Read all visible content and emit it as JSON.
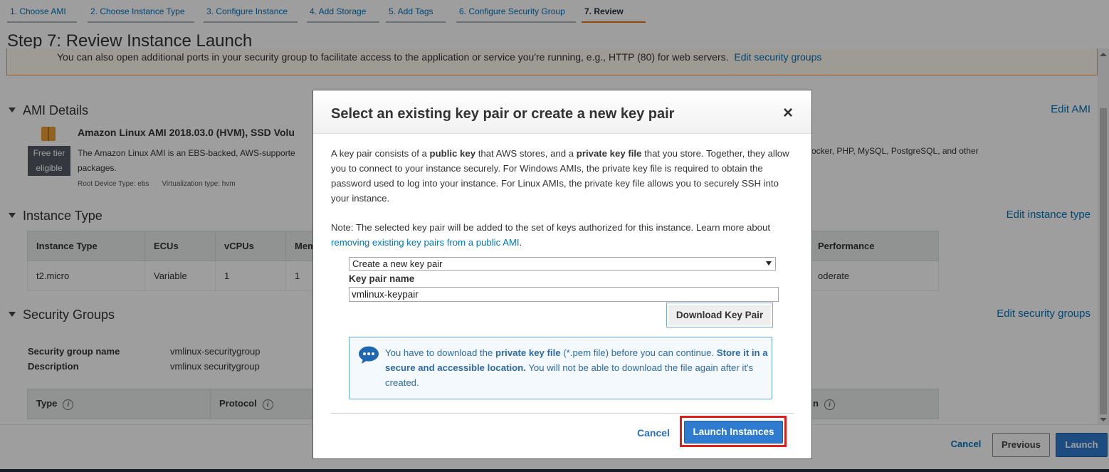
{
  "wizard_tabs": [
    {
      "label": "1. Choose AMI"
    },
    {
      "label": "2. Choose Instance Type"
    },
    {
      "label": "3. Configure Instance"
    },
    {
      "label": "4. Add Storage"
    },
    {
      "label": "5. Add Tags"
    },
    {
      "label": "6. Configure Security Group"
    },
    {
      "label": "7. Review"
    }
  ],
  "page": {
    "title": "Step 7: Review Instance Launch",
    "notice_text": "You can also open additional ports in your security group to facilitate access to the application or service you're running, e.g., HTTP (80) for web servers.",
    "notice_link": "Edit security groups"
  },
  "ami_section": {
    "heading": "AMI Details",
    "edit_link": "Edit AMI",
    "ami_title": "Amazon Linux AMI 2018.03.0 (HVM), SSD Volu",
    "free_tier_line1": "Free tier",
    "free_tier_line2": "eligible",
    "desc_left": "The Amazon Linux AMI is an EBS-backed, AWS-supporte",
    "desc_right": "ocker, PHP, MySQL, PostgreSQL, and other",
    "desc_line2": "packages.",
    "root_device": "Root Device Type: ebs",
    "virtualization": "Virtualization type: hvm"
  },
  "instance_section": {
    "heading": "Instance Type",
    "edit_link": "Edit instance type",
    "columns": [
      "Instance Type",
      "ECUs",
      "vCPUs",
      "Mem",
      "Performance"
    ],
    "row": [
      "t2.micro",
      "Variable",
      "1",
      "1",
      "oderate"
    ]
  },
  "security_section": {
    "heading": "Security Groups",
    "edit_link": "Edit security groups",
    "name_label": "Security group name",
    "name_value": "vmlinux-securitygroup",
    "desc_label": "Description",
    "desc_value": "vmlinux securitygroup",
    "columns": [
      "Type",
      "Protocol",
      "n"
    ]
  },
  "footer": {
    "cancel": "Cancel",
    "previous": "Previous",
    "launch": "Launch"
  },
  "modal": {
    "title": "Select an existing key pair or create a new key pair",
    "close": "×",
    "para1_a": "A key pair consists of a ",
    "para1_b": "public key",
    "para1_c": " that AWS stores, and a ",
    "para1_d": "private key file",
    "para1_e": " that you store. Together, they allow you to connect to your instance securely. For Windows AMIs, the private key file is required to obtain the password used to log into your instance. For Linux AMIs, the private key file allows you to securely SSH into your instance.",
    "note_a": "Note: The selected key pair will be added to the set of keys authorized for this instance. Learn more about ",
    "note_link": "removing existing key pairs from a public AMI",
    "note_end": ".",
    "select_value": "Create a new key pair",
    "key_pair_label": "Key pair name",
    "key_pair_value": "vmlinux-keypair",
    "download_button": "Download Key Pair",
    "info_a": "You have to download the ",
    "info_b": "private key file",
    "info_c": " (*.pem file) before you can continue. ",
    "info_d": "Store it in a secure and accessible location.",
    "info_e": " You will not be able to download the file again after it's created.",
    "cancel": "Cancel",
    "launch_button": "Launch Instances"
  },
  "colors": {
    "link": "#0073bb",
    "primary_button": "#2e7bcf",
    "highlight": "#e01e1e",
    "active_tab_underline": "#ec7211"
  }
}
